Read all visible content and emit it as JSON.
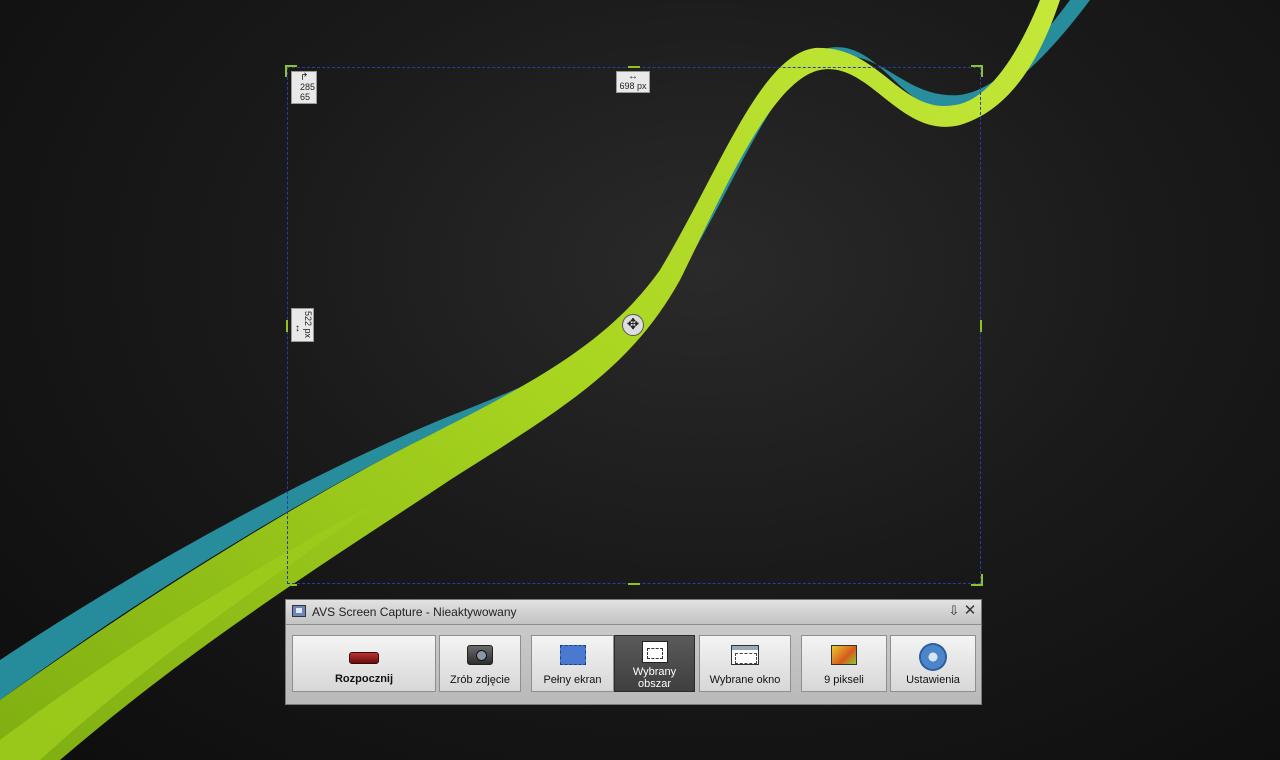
{
  "selection": {
    "position_x": "285",
    "position_y": "65",
    "width_label": "698 px",
    "height_label": "522 px"
  },
  "app": {
    "title": "AVS Screen Capture - Nieaktywowany",
    "buttons": {
      "start": "Rozpocznij",
      "photo": "Zrób zdjęcie",
      "full_screen": "Pełny ekran",
      "selected_area": "Wybrany obszar",
      "selected_window": "Wybrane okno",
      "pixels": "9 pikseli",
      "settings": "Ustawienia"
    },
    "active_mode": "selected_area"
  },
  "icons": {
    "pin": "pin-icon",
    "close": "close-icon",
    "move": "move-cursor-icon"
  },
  "colors": {
    "selection_border": "#2a3aa8",
    "handle": "#8fc31f",
    "active_button": "#4a4a4a"
  }
}
